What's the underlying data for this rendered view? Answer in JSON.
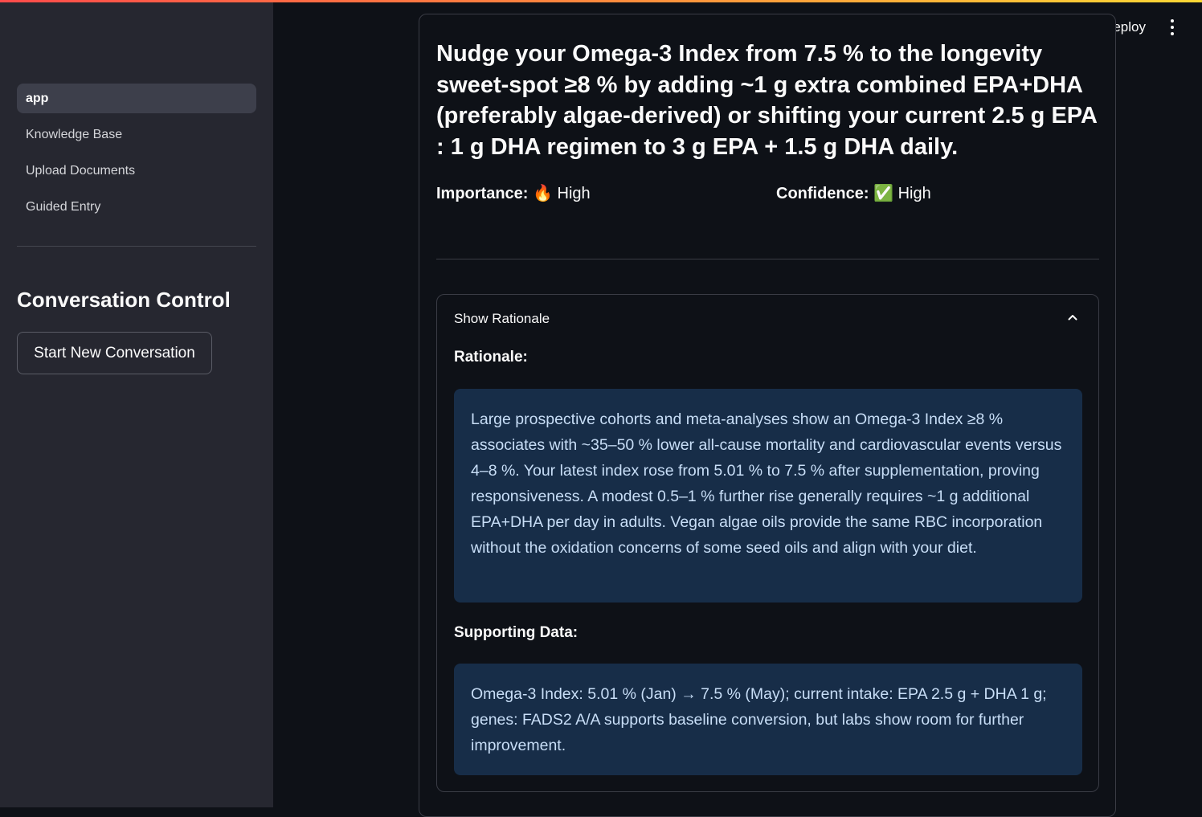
{
  "sidebar": {
    "nav": [
      {
        "label": "app",
        "active": true
      },
      {
        "label": "Knowledge Base",
        "active": false
      },
      {
        "label": "Upload Documents",
        "active": false
      },
      {
        "label": "Guided Entry",
        "active": false
      }
    ],
    "section_title": "Conversation Control",
    "new_conversation_button": "Start New Conversation"
  },
  "header": {
    "deploy_label": "Deploy",
    "menu_icon": "kebab-menu-icon"
  },
  "recommendation": {
    "title": "Nudge your Omega-3 Index from 7.5 % to the longevity sweet-spot ≥8 % by adding ~1 g extra combined EPA+DHA (preferably algae-derived) or shifting your current 2.5 g EPA : 1 g DHA regimen to 3 g EPA + 1.5 g DHA daily.",
    "importance_label": "Importance:",
    "importance_icon": "🔥",
    "importance_value": "High",
    "confidence_label": "Confidence:",
    "confidence_icon": "✅",
    "confidence_value": "High"
  },
  "expander": {
    "label": "Show Rationale",
    "expanded": true,
    "rationale_heading": "Rationale:",
    "rationale_text": "Large prospective cohorts and meta-analyses show an Omega-3 Index ≥8 % associates with ~35–50 % lower all-cause mortality and cardiovascular events versus 4–8 %. Your latest index rose from 5.01 % to 7.5 % after supplementation, proving responsiveness. A modest 0.5–1 % further rise generally requires ~1 g additional EPA+DHA per day in adults. Vegan algae oils provide the same RBC incorporation without the oxidation concerns of some seed oils and align with your diet.",
    "supporting_heading": "Supporting Data:",
    "supporting_text": "Omega-3 Index: 5.01 % (Jan) → 7.5 % (May); current intake: EPA 2.5 g + DHA 1 g; genes: FADS2 A/A supports baseline conversion, but labs show room for further improvement."
  },
  "colors": {
    "background": "#0e1117",
    "sidebar": "#262730",
    "info_box": "#172d48",
    "info_text": "#c8def7"
  }
}
